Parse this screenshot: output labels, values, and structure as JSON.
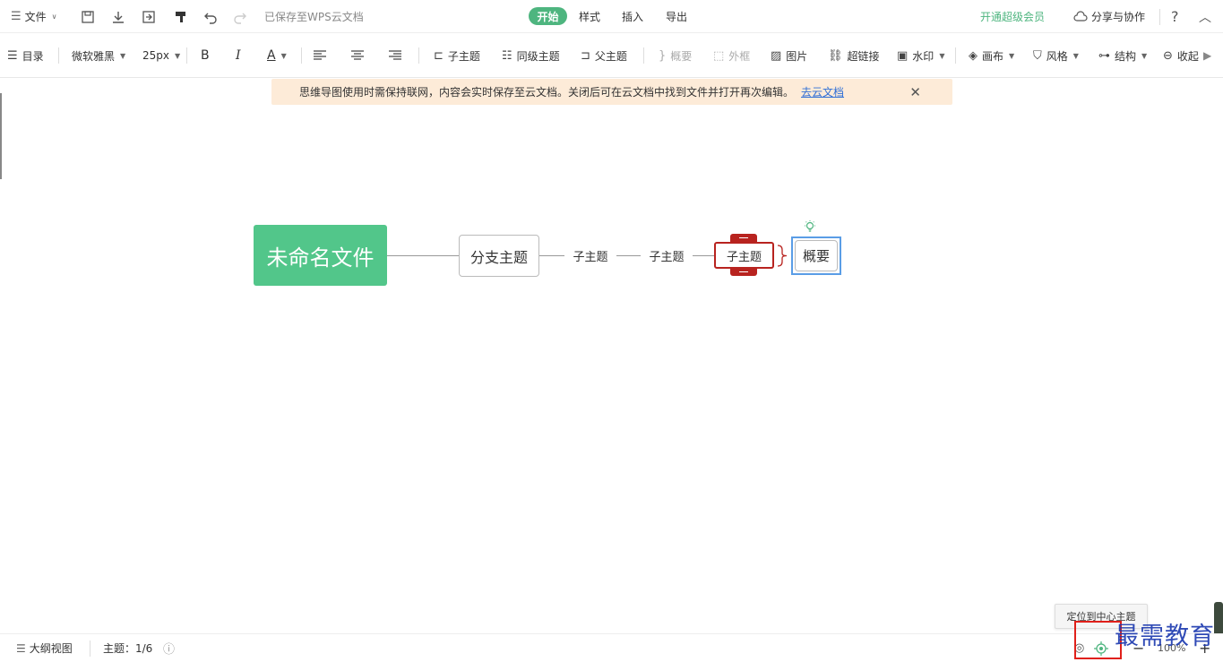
{
  "colors": {
    "accent": "#4eb57f",
    "root_bg": "#52c68a",
    "selected_red": "#b8231f",
    "summary_blue": "#5a9de6",
    "banner_bg": "#fdebd8",
    "link_blue": "#2f6fd6",
    "highlight_red": "#e0201a",
    "watermark_blue": "#1e3bb0"
  },
  "topbar": {
    "menu_icon": "hamburger-icon",
    "file_label": "文件",
    "saved_status": "已保存至WPS云文档",
    "tabs": [
      "开始",
      "样式",
      "插入",
      "导出"
    ],
    "active_tab": "开始",
    "vip_label": "开通超级会员",
    "share_label": "分享与协作",
    "help_label": "?"
  },
  "toolbar": {
    "outline_label": "目录",
    "font_family": "微软雅黑",
    "font_size": "25px",
    "bold": "B",
    "italic": "I",
    "font_color": "A",
    "child_topic": "子主题",
    "sibling_topic": "同级主题",
    "parent_topic": "父主题",
    "summary": "概要",
    "frame": "外框",
    "image": "图片",
    "hyperlink": "超链接",
    "watermark": "水印",
    "canvas": "画布",
    "style": "风格",
    "structure": "结构",
    "collapse": "收起"
  },
  "banner": {
    "message": "思维导图使用时需保持联网，内容会实时保存至云文档。关闭后可在云文档中找到文件并打开再次编辑。",
    "link": "去云文档"
  },
  "mindmap": {
    "root": "未命名文件",
    "branch": "分支主题",
    "child1": "子主题",
    "child2": "子主题",
    "child3": "子主题",
    "summary": "概要"
  },
  "statusbar": {
    "outline_view": "大纲视图",
    "topic_count_label": "主题：1/6",
    "tooltip": "定位到中心主题",
    "zoom": "100%",
    "zoom_out": "−",
    "zoom_in": "+"
  },
  "watermark_text": "最需教育"
}
